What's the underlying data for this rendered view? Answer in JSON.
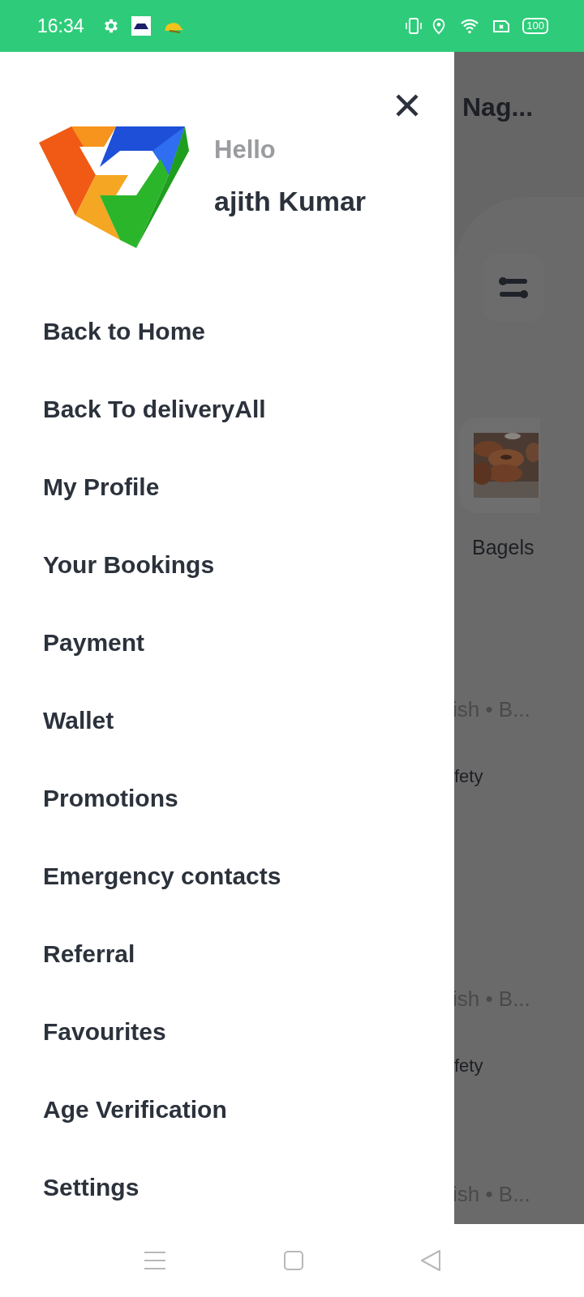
{
  "status_bar": {
    "time": "16:34",
    "battery": "100"
  },
  "drawer": {
    "greeting": "Hello",
    "user_name": "ajith Kumar",
    "menu_items": [
      "Back to Home",
      "Back To deliveryAll",
      "My Profile",
      "Your Bookings",
      "Payment",
      "Wallet",
      "Promotions",
      "Emergency contacts",
      "Referral",
      "Favourites",
      "Age Verification",
      "Settings"
    ]
  },
  "background": {
    "title": "Nag...",
    "category": "Bagels",
    "rows": [
      {
        "subtitle": "ish • B...",
        "note": "fety"
      },
      {
        "subtitle": "ish • B...",
        "note": "fety"
      },
      {
        "subtitle": "ish • B..."
      }
    ]
  }
}
